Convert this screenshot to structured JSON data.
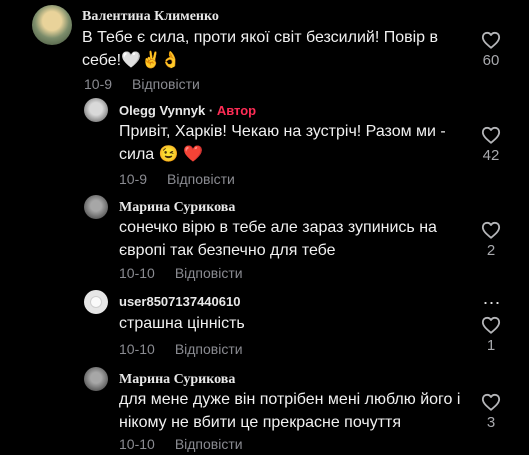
{
  "comments": [
    {
      "author": "Валентина Клименко",
      "text_line1": "В Тебе є сила, проти якої світ безсилий! Повір в",
      "text_line2": "себе!🤍✌️👌",
      "date": "10-9",
      "reply_label": "Відповісти",
      "likes": "60"
    },
    {
      "author": "Olegg Vynnyk",
      "author_tag": "Автор",
      "separator": "·",
      "text_line1": "Привіт, Харків! Чекаю на зустріч! Разом ми -",
      "text_line2": "сила 😉 ❤️",
      "date": "10-9",
      "reply_label": "Відповісти",
      "likes": "42"
    },
    {
      "author": "Марина Сурикова",
      "text_line1": "сонечко вірю в тебе але зараз зупинись на",
      "text_line2": "європі так безпечно для тебе",
      "date": "10-10",
      "reply_label": "Відповісти",
      "likes": "2"
    },
    {
      "author": "user8507137440610",
      "text_line1": "страшна цінність",
      "date": "10-10",
      "reply_label": "Відповісти",
      "likes": "1",
      "more_icon": "⋯"
    },
    {
      "author": "Марина Сурикова",
      "text_line1": "для мене дуже він потрібен мені люблю його і",
      "text_line2": "нікому не вбити це прекрасне почуття",
      "date": "10-10",
      "reply_label": "Відповісти",
      "likes": "3"
    }
  ],
  "icons": {
    "like": "heart-outline-icon",
    "more": "more-dots-icon"
  },
  "colors": {
    "background": "#000000",
    "author_tag": "#fe2c55",
    "muted": "#8a8b91"
  }
}
